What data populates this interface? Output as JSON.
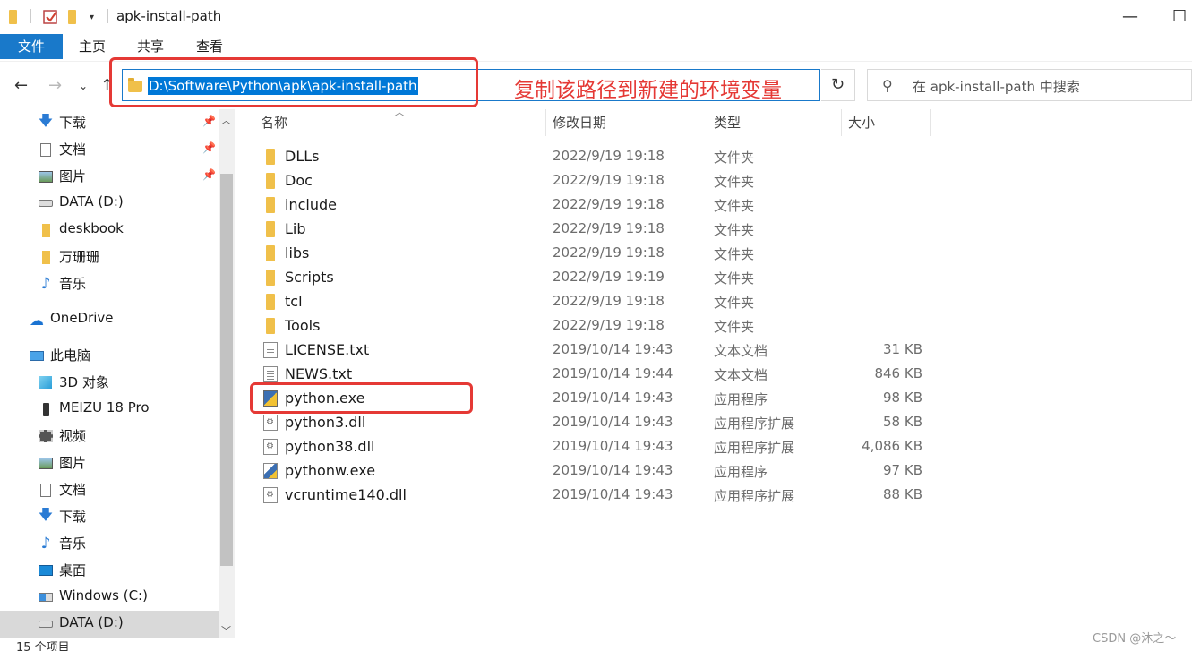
{
  "window": {
    "title": "apk-install-path",
    "minimize": "—",
    "maximize": "☐"
  },
  "ribbon": {
    "tabs": [
      "文件",
      "主页",
      "共享",
      "查看"
    ]
  },
  "address": {
    "path": "D:\\Software\\Python\\apk\\apk-install-path",
    "annotation": "复制该路径到新建的环境变量",
    "search_placeholder": "在 apk-install-path 中搜索"
  },
  "nav": {
    "items": [
      {
        "label": "下载",
        "icon": "download-arrow-icon",
        "pinned": true
      },
      {
        "label": "文档",
        "icon": "document-icon",
        "pinned": true
      },
      {
        "label": "图片",
        "icon": "picture-icon",
        "pinned": true
      },
      {
        "label": "DATA (D:)",
        "icon": "drive-icon",
        "pinned": false
      },
      {
        "label": "deskbook",
        "icon": "folder-icon",
        "pinned": false
      },
      {
        "label": "万珊珊",
        "icon": "folder-icon",
        "pinned": false
      },
      {
        "label": "音乐",
        "icon": "music-note-icon",
        "pinned": false
      },
      {
        "label": "OneDrive",
        "icon": "cloud-icon",
        "pinned": false
      },
      {
        "label": "此电脑",
        "icon": "computer-icon",
        "pinned": false
      },
      {
        "label": "3D 对象",
        "icon": "cube-icon",
        "pinned": false
      },
      {
        "label": "MEIZU 18 Pro",
        "icon": "phone-icon",
        "pinned": false
      },
      {
        "label": "视频",
        "icon": "video-icon",
        "pinned": false
      },
      {
        "label": "图片",
        "icon": "picture-icon",
        "pinned": false
      },
      {
        "label": "文档",
        "icon": "document-icon",
        "pinned": false
      },
      {
        "label": "下载",
        "icon": "download-arrow-icon",
        "pinned": false
      },
      {
        "label": "音乐",
        "icon": "music-note-icon",
        "pinned": false
      },
      {
        "label": "桌面",
        "icon": "desktop-icon",
        "pinned": false
      },
      {
        "label": "Windows (C:)",
        "icon": "windows-drive-icon",
        "pinned": false
      },
      {
        "label": "DATA (D:)",
        "icon": "drive-icon",
        "pinned": false,
        "selected": true
      }
    ]
  },
  "columns": {
    "name": "名称",
    "modified": "修改日期",
    "type": "类型",
    "size": "大小"
  },
  "files": [
    {
      "name": "DLLs",
      "date": "2022/9/19 19:18",
      "type": "文件夹",
      "size": "",
      "kind": "folder"
    },
    {
      "name": "Doc",
      "date": "2022/9/19 19:18",
      "type": "文件夹",
      "size": "",
      "kind": "folder"
    },
    {
      "name": "include",
      "date": "2022/9/19 19:18",
      "type": "文件夹",
      "size": "",
      "kind": "folder"
    },
    {
      "name": "Lib",
      "date": "2022/9/19 19:18",
      "type": "文件夹",
      "size": "",
      "kind": "folder"
    },
    {
      "name": "libs",
      "date": "2022/9/19 19:18",
      "type": "文件夹",
      "size": "",
      "kind": "folder"
    },
    {
      "name": "Scripts",
      "date": "2022/9/19 19:19",
      "type": "文件夹",
      "size": "",
      "kind": "folder"
    },
    {
      "name": "tcl",
      "date": "2022/9/19 19:18",
      "type": "文件夹",
      "size": "",
      "kind": "folder"
    },
    {
      "name": "Tools",
      "date": "2022/9/19 19:18",
      "type": "文件夹",
      "size": "",
      "kind": "folder"
    },
    {
      "name": "LICENSE.txt",
      "date": "2019/10/14 19:43",
      "type": "文本文档",
      "size": "31 KB",
      "kind": "txt"
    },
    {
      "name": "NEWS.txt",
      "date": "2019/10/14 19:44",
      "type": "文本文档",
      "size": "846 KB",
      "kind": "txt"
    },
    {
      "name": "python.exe",
      "date": "2019/10/14 19:43",
      "type": "应用程序",
      "size": "98 KB",
      "kind": "exe"
    },
    {
      "name": "python3.dll",
      "date": "2019/10/14 19:43",
      "type": "应用程序扩展",
      "size": "58 KB",
      "kind": "dll"
    },
    {
      "name": "python38.dll",
      "date": "2019/10/14 19:43",
      "type": "应用程序扩展",
      "size": "4,086 KB",
      "kind": "dll"
    },
    {
      "name": "pythonw.exe",
      "date": "2019/10/14 19:43",
      "type": "应用程序",
      "size": "97 KB",
      "kind": "exew"
    },
    {
      "name": "vcruntime140.dll",
      "date": "2019/10/14 19:43",
      "type": "应用程序扩展",
      "size": "88 KB",
      "kind": "dll"
    }
  ],
  "status": {
    "count": "15 个项目"
  },
  "watermark": "CSDN @沐之～",
  "colors": {
    "accent": "#1979ca",
    "selection": "#0078d7",
    "annotation_red": "#e53935"
  }
}
